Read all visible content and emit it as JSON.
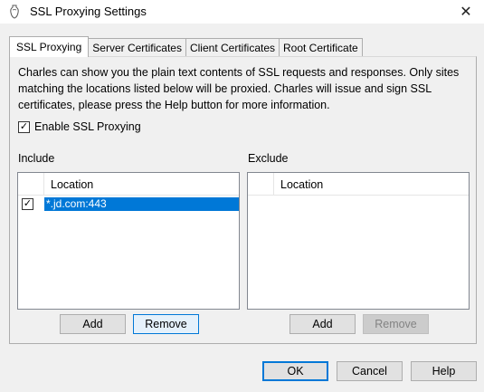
{
  "window": {
    "title": "SSL Proxying Settings",
    "close_glyph": "✕"
  },
  "tabs": [
    {
      "label": "SSL Proxying",
      "active": true
    },
    {
      "label": "Server Certificates",
      "active": false
    },
    {
      "label": "Client Certificates",
      "active": false
    },
    {
      "label": "Root Certificate",
      "active": false
    }
  ],
  "description": "Charles can show you the plain text contents of SSL requests and responses. Only sites matching the locations listed below will be proxied. Charles will issue and sign SSL certificates, please press the Help button for more information.",
  "enable_ssl": {
    "label": "Enable SSL Proxying",
    "checked": true,
    "check_glyph": "✓"
  },
  "include": {
    "label": "Include",
    "column": "Location",
    "rows": [
      {
        "location": "*.jd.com:443",
        "checked": true,
        "selected": true
      }
    ],
    "add_label": "Add",
    "remove_label": "Remove"
  },
  "exclude": {
    "label": "Exclude",
    "column": "Location",
    "rows": [],
    "add_label": "Add",
    "remove_label": "Remove"
  },
  "footer": {
    "ok_label": "OK",
    "cancel_label": "Cancel",
    "help_label": "Help"
  },
  "colors": {
    "selection": "#0078d7",
    "focus": "#0078d7"
  },
  "icons": {
    "title_icon": "charles-vase-icon",
    "close": "close-icon"
  }
}
